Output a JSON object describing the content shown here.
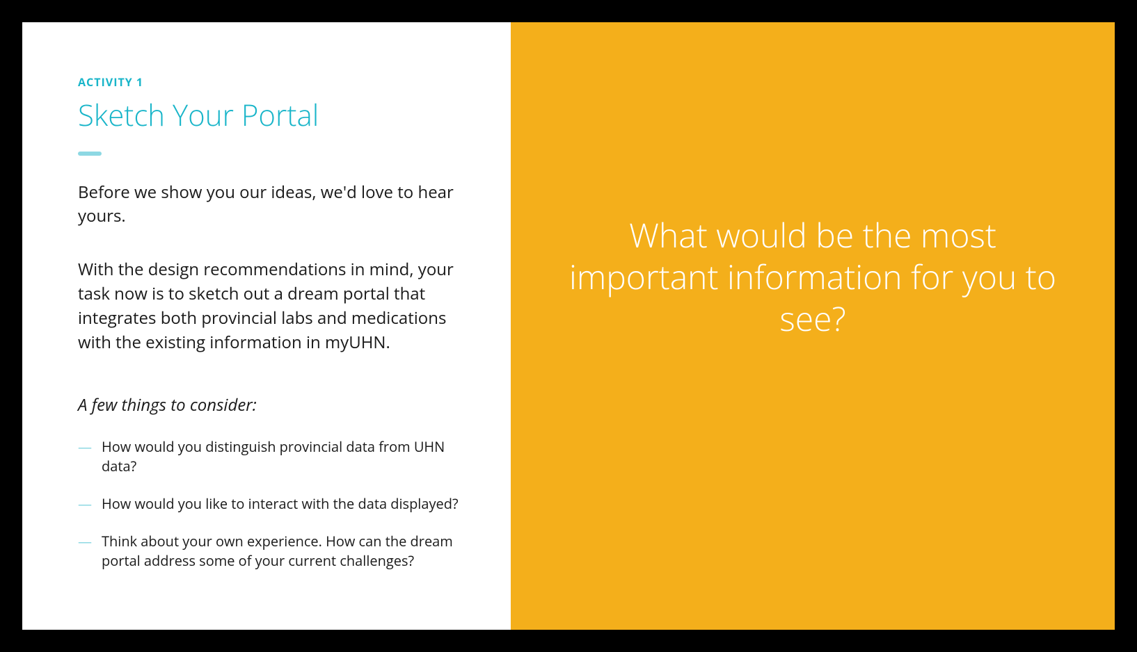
{
  "left": {
    "eyebrow": "ACTIVITY 1",
    "title": "Sketch Your Portal",
    "intro": "Before we show you our ideas, we'd love to hear yours.",
    "task": "With the design recommendations in mind, your task now is to sketch out a dream portal that integrates both provincial labs and medications with the existing information in myUHN.",
    "consider_heading": "A few things to consider:",
    "consider_items": [
      "How would you distinguish provincial data from UHN data?",
      "How would you like to interact with the data displayed?",
      "Think about your own experience. How can the dream portal address some of your current challenges?"
    ]
  },
  "right": {
    "prompt": "What would be the most important information for you to see?"
  },
  "colors": {
    "accent_teal": "#19B5C9",
    "accent_light_teal": "#8DD8E3",
    "panel_orange": "#F4AF1B",
    "text_dark": "#1a1a1a",
    "text_white": "#ffffff",
    "frame_black": "#000000"
  }
}
